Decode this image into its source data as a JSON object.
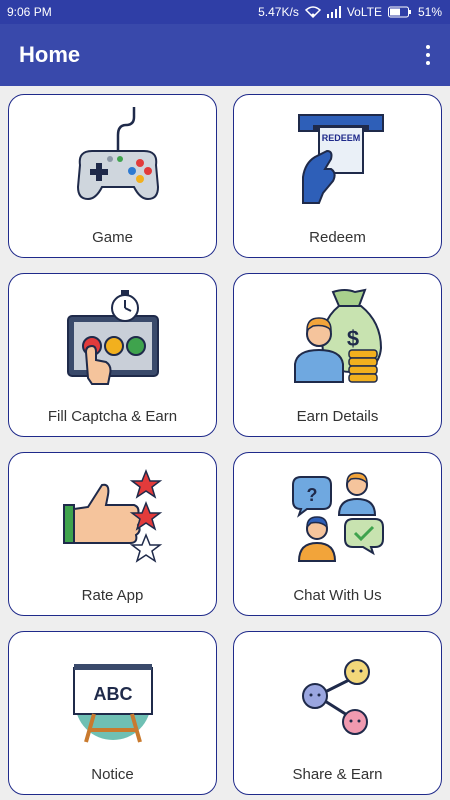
{
  "status_bar": {
    "time": "9:06 PM",
    "network_speed": "5.47K/s",
    "network_type": "VoLTE",
    "battery": "51%"
  },
  "app_bar": {
    "title": "Home",
    "menu_icon": "more-vert-icon"
  },
  "tiles": [
    {
      "label": "Game",
      "icon": "gamepad-icon"
    },
    {
      "label": "Redeem",
      "icon": "redeem-icon",
      "icon_text": "REDEEM"
    },
    {
      "label": "Fill Captcha & Earn",
      "icon": "captcha-icon"
    },
    {
      "label": "Earn Details",
      "icon": "money-bag-icon"
    },
    {
      "label": "Rate App",
      "icon": "thumbs-up-stars-icon"
    },
    {
      "label": "Chat With Us",
      "icon": "chat-icon"
    },
    {
      "label": "Notice",
      "icon": "notice-board-icon",
      "icon_text": "ABC"
    },
    {
      "label": "Share & Earn",
      "icon": "share-icon"
    }
  ],
  "colors": {
    "primary": "#3949ab",
    "primary_dark": "#2f3ea6",
    "card_border": "#1f2a8a",
    "background": "#eeeeee"
  }
}
